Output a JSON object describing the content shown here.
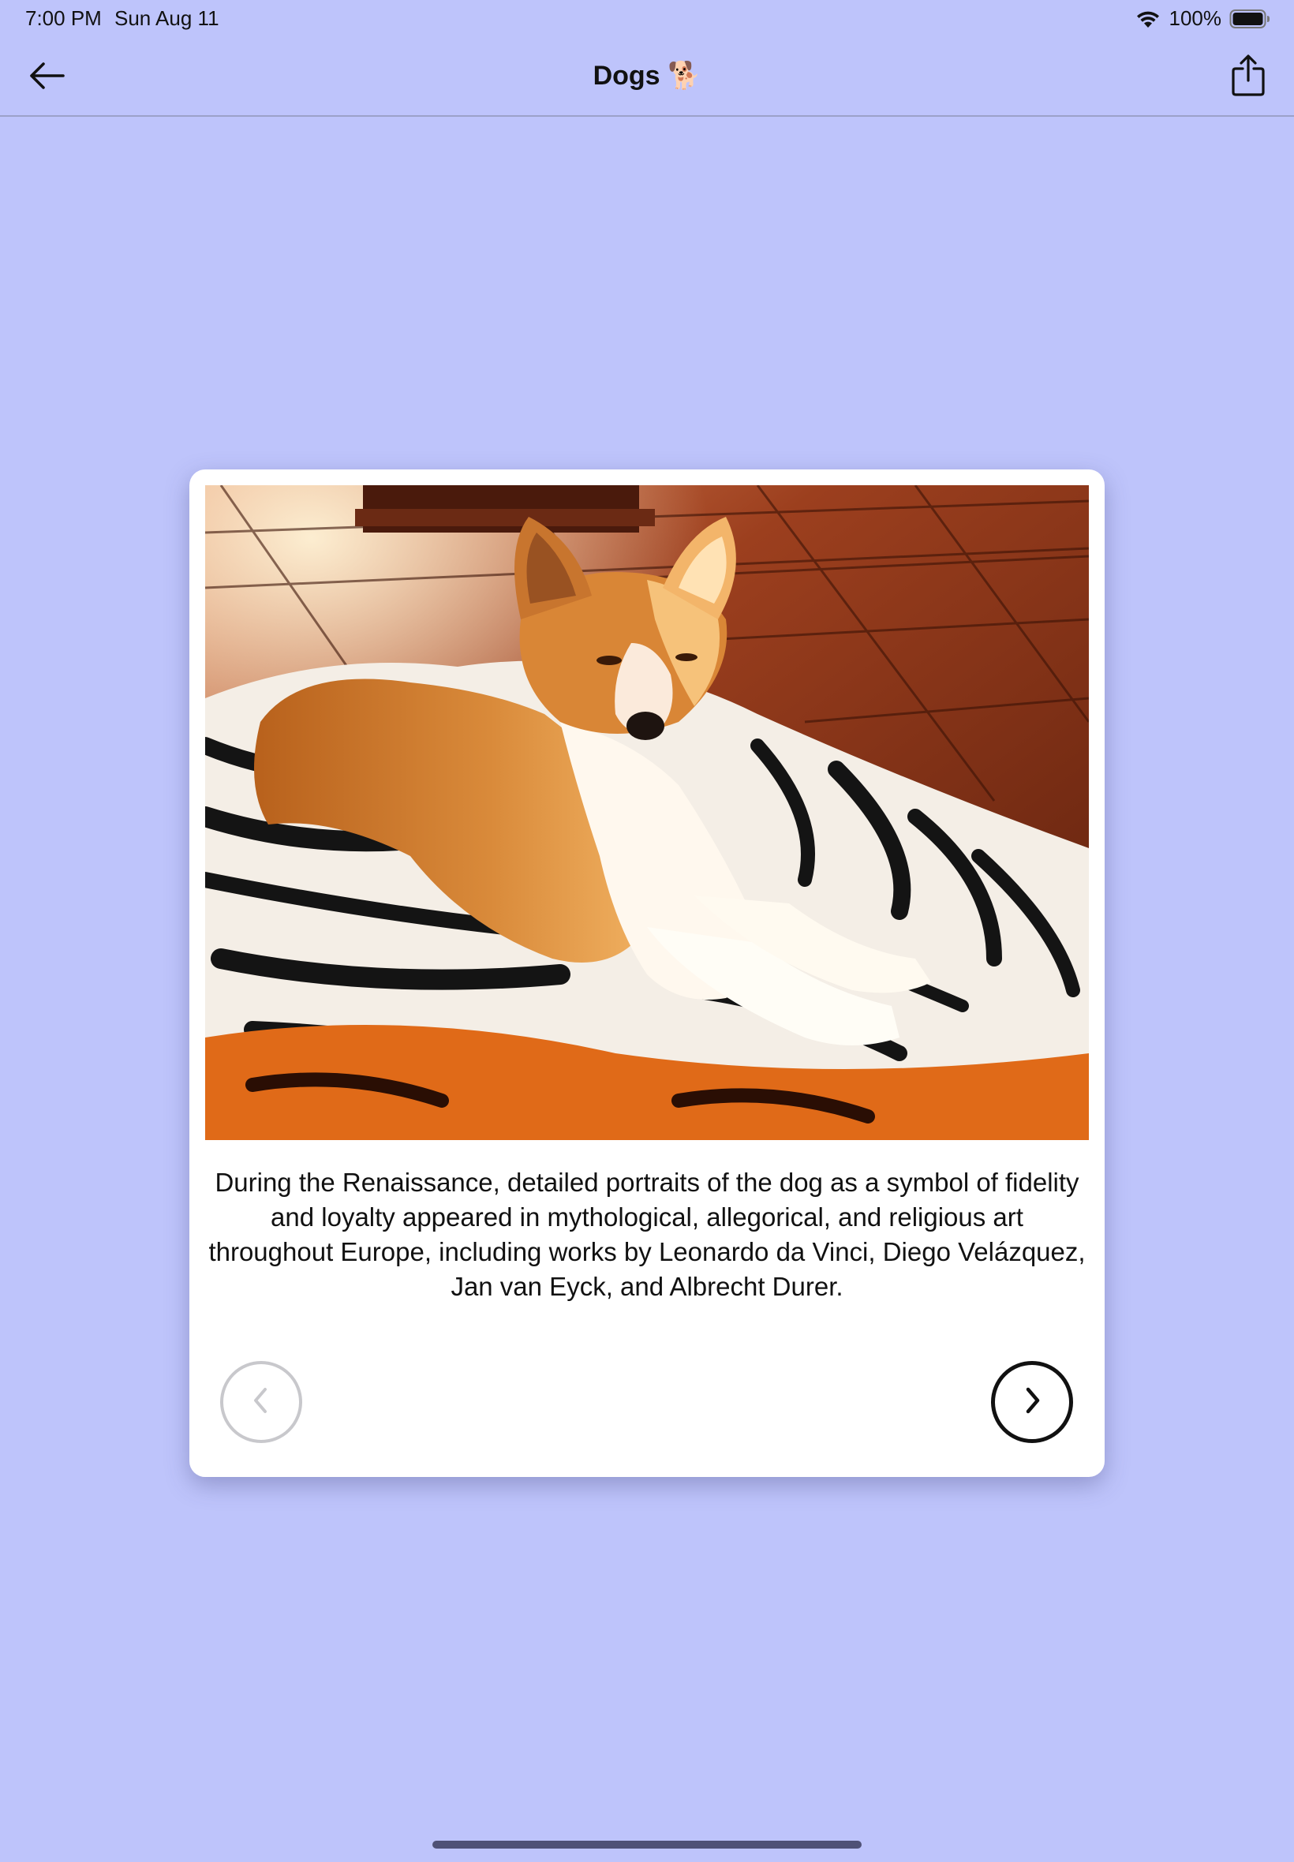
{
  "status_bar": {
    "time": "7:00 PM",
    "date": "Sun Aug 11",
    "battery": "100%",
    "icons": [
      "wifi-icon",
      "battery-icon"
    ]
  },
  "nav": {
    "title": "Dogs",
    "title_emoji": "🐕",
    "back_icon": "arrow-left-icon",
    "share_icon": "share-icon"
  },
  "card": {
    "image_description_icon": "dog-photo",
    "text": "During the Renaissance, detailed portraits of the dog as a symbol of fidelity and loyalty appeared in mythological, allegorical, and religious art throughout Europe, including works by Leonardo da Vinci, Diego Velázquez, Jan van Eyck, and Albrecht Durer.",
    "prev_icon": "chevron-left-icon",
    "next_icon": "chevron-right-icon",
    "prev_enabled": false,
    "next_enabled": true
  },
  "colors": {
    "background": "#BEC4FB",
    "card": "#FFFFFF",
    "disabled": "#C8C8CC",
    "enabled": "#111111"
  }
}
